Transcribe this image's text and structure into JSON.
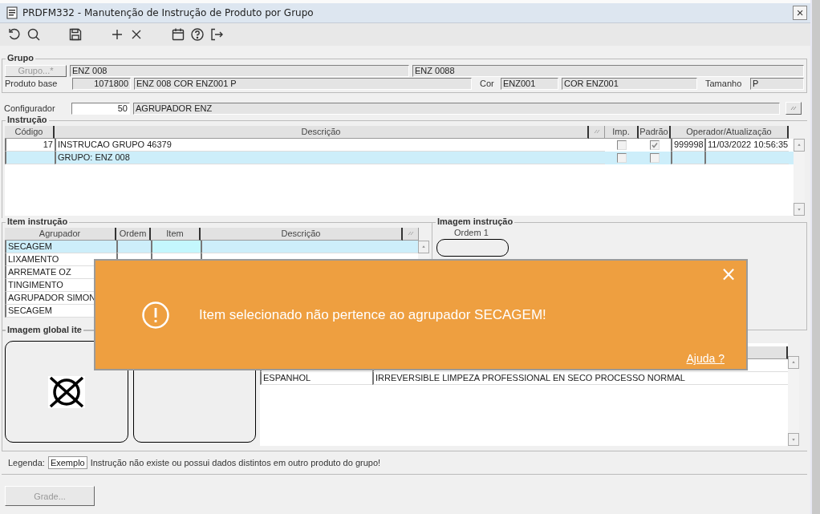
{
  "window": {
    "title": "PRDFM332 - Manutenção de Instrução de Produto por Grupo",
    "close": "×"
  },
  "grupo": {
    "legend": "Grupo",
    "button": "Grupo...*",
    "button_disabled": true,
    "code": "ENZ 008",
    "name": "ENZ 0088",
    "produto_base_label": "Produto base",
    "produto_base_code": "1071800",
    "produto_base_desc": "ENZ 008 COR ENZ001 P",
    "cor_label": "Cor",
    "cor_code": "ENZ001",
    "cor_desc": "COR ENZ001",
    "tamanho_label": "Tamanho",
    "tamanho": "P"
  },
  "configurador": {
    "label": "Configurador",
    "code": "50",
    "desc": "AGRUPADOR ENZ"
  },
  "instrucao": {
    "legend": "Instrução",
    "columns": [
      "Código",
      "Descrição",
      "Imp.",
      "Padrão",
      "Operador/Atualização"
    ],
    "rows": [
      {
        "codigo": "17",
        "descricao": "INSTRUCAO GRUPO 46379",
        "imp": false,
        "padrao": true,
        "operador": "999998",
        "atualizacao": "11/03/2022 10:56:35",
        "selected": false
      },
      {
        "descricao": "GRUPO: ENZ 008",
        "imp": false,
        "padrao": false,
        "selected": true
      }
    ]
  },
  "item_instrucao": {
    "legend": "Item instrução",
    "columns": [
      "Agrupador",
      "Ordem",
      "Item",
      "Descrição"
    ],
    "rows": [
      {
        "agrupador": "SECAGEM",
        "selected": true
      },
      {
        "agrupador": "LIXAMENTO",
        "selected": false
      },
      {
        "agrupador": "ARREMATE OZ",
        "selected": false
      },
      {
        "agrupador": "TINGIMENTO",
        "selected": false
      },
      {
        "agrupador": "AGRUPADOR  SIMON",
        "selected": false
      },
      {
        "agrupador": "SECAGEM",
        "selected": false
      }
    ]
  },
  "imagem_instrucao": {
    "legend": "Imagem instrução",
    "caption": "Ordem 1"
  },
  "imagem_global": {
    "legend": "Imagem global ite"
  },
  "idiomas": {
    "rows": [
      {
        "idioma": "ESPANHOL",
        "texto": "IRREVERSIBLE LIMPEZA PROFESSIONAL EN SECO PROCESSO NORMAL"
      }
    ]
  },
  "legenda": {
    "label": "Legenda:",
    "sample": "Exemplo",
    "text": "Instrução não existe ou possui dados distintos em outro produto do grupo!"
  },
  "grade_button": {
    "label": "Grade...",
    "disabled": true
  },
  "toast": {
    "message": "Item selecionado não pertence ao agrupador SECAGEM!",
    "help": "Ajuda ?",
    "close": "×"
  }
}
